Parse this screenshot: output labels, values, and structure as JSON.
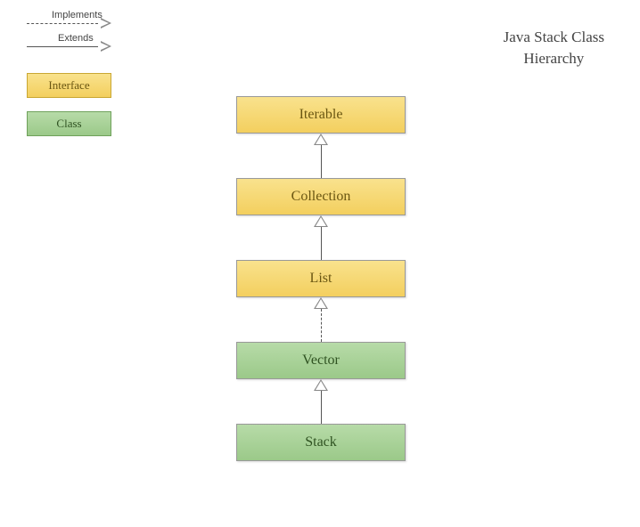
{
  "title": {
    "line1": "Java Stack Class",
    "line2": "Hierarchy"
  },
  "legend": {
    "implements_label": "Implements",
    "extends_label": "Extends",
    "interface_label": "Interface",
    "class_label": "Class"
  },
  "nodes": {
    "iterable": "Iterable",
    "collection": "Collection",
    "list": "List",
    "vector": "Vector",
    "stack": "Stack"
  },
  "chart_data": {
    "type": "diagram",
    "title": "Java Stack Class Hierarchy",
    "legend": [
      {
        "style": "dashed-open-arrow",
        "meaning": "Implements"
      },
      {
        "style": "solid-open-arrow",
        "meaning": "Extends"
      },
      {
        "style": "yellow-box",
        "meaning": "Interface"
      },
      {
        "style": "green-box",
        "meaning": "Class"
      }
    ],
    "nodes": [
      {
        "id": "Iterable",
        "kind": "Interface"
      },
      {
        "id": "Collection",
        "kind": "Interface"
      },
      {
        "id": "List",
        "kind": "Interface"
      },
      {
        "id": "Vector",
        "kind": "Class"
      },
      {
        "id": "Stack",
        "kind": "Class"
      }
    ],
    "edges": [
      {
        "from": "Collection",
        "to": "Iterable",
        "relation": "extends"
      },
      {
        "from": "List",
        "to": "Collection",
        "relation": "extends"
      },
      {
        "from": "Vector",
        "to": "List",
        "relation": "implements"
      },
      {
        "from": "Stack",
        "to": "Vector",
        "relation": "extends"
      }
    ]
  }
}
